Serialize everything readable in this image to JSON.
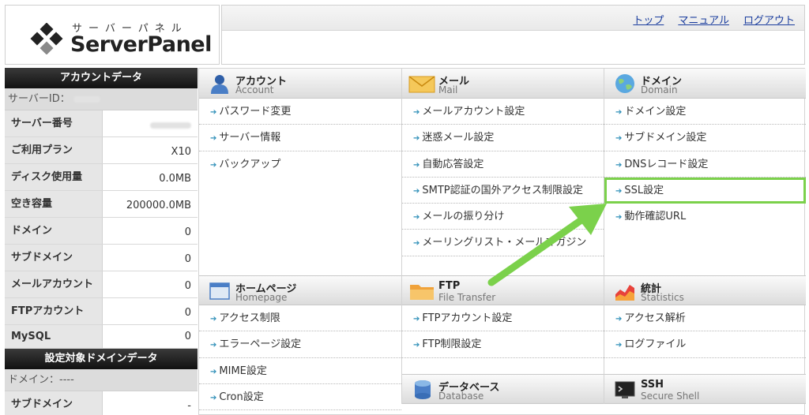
{
  "header": {
    "logo_kana": "サーバーパネル",
    "logo_text": "ServerPanel",
    "links": [
      "トップ",
      "マニュアル",
      "ログアウト"
    ]
  },
  "sidebar": {
    "account_title": "アカウントデータ",
    "server_id_label": "サーバーID：",
    "rows": [
      {
        "label": "サーバー番号",
        "value": ""
      },
      {
        "label": "ご利用プラン",
        "value": "X10"
      },
      {
        "label": "ディスク使用量",
        "value": "0.0MB"
      },
      {
        "label": "空き容量",
        "value": "200000.0MB"
      },
      {
        "label": "ドメイン",
        "value": "0"
      },
      {
        "label": "サブドメイン",
        "value": "0"
      },
      {
        "label": "メールアカウント",
        "value": "0"
      },
      {
        "label": "FTPアカウント",
        "value": "0"
      },
      {
        "label": "MySQL",
        "value": "0"
      }
    ],
    "domain_title": "設定対象ドメインデータ",
    "domain_label": "ドメイン：----",
    "subdomain_row": {
      "label": "サブドメイン",
      "value": "-"
    }
  },
  "panels": {
    "account": {
      "title": "アカウント",
      "en": "Account",
      "items": [
        "パスワード変更",
        "サーバー情報",
        "バックアップ"
      ]
    },
    "mail": {
      "title": "メール",
      "en": "Mail",
      "items": [
        "メールアカウント設定",
        "迷惑メール設定",
        "自動応答設定",
        "SMTP認証の国外アクセス制限設定",
        "メールの振り分け",
        "メーリングリスト・メールマガジン"
      ]
    },
    "domain": {
      "title": "ドメイン",
      "en": "Domain",
      "items": [
        "ドメイン設定",
        "サブドメイン設定",
        "DNSレコード設定",
        "SSL設定",
        "動作確認URL"
      ]
    },
    "homepage": {
      "title": "ホームページ",
      "en": "Homepage",
      "items": [
        "アクセス制限",
        "エラーページ設定",
        "MIME設定",
        "Cron設定"
      ]
    },
    "ftp": {
      "title": "FTP",
      "en": "File Transfer",
      "items": [
        "FTPアカウント設定",
        "FTP制限設定"
      ]
    },
    "stats": {
      "title": "統計",
      "en": "Statistics",
      "items": [
        "アクセス解析",
        "ログファイル"
      ]
    },
    "database": {
      "title": "データベース",
      "en": "Database"
    },
    "ssh": {
      "title": "SSH",
      "en": "Secure Shell"
    }
  },
  "colors": {
    "highlight": "#7bd14b",
    "link": "#1a3d9e"
  }
}
